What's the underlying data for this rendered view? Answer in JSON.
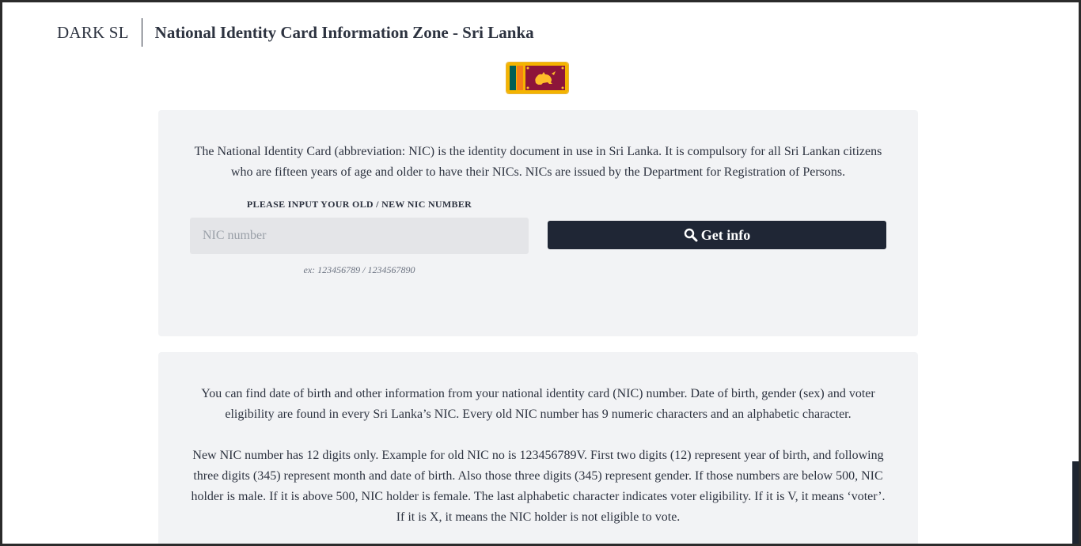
{
  "header": {
    "brand": "DARK SL",
    "title": "National Identity Card Information Zone - Sri Lanka"
  },
  "flag": {
    "icon": "sri-lanka-flag",
    "colors": {
      "border": "#f4b400",
      "green": "#005f56",
      "orange": "#f57f17",
      "maroon": "#8d153a",
      "lion": "#ffbe29"
    }
  },
  "lookup": {
    "intro": "The National Identity Card (abbreviation: NIC) is the identity document in use in Sri Lanka. It is compulsory for all Sri Lankan citizens who are fifteen years of age and older to have their NICs. NICs are issued by the Department for Registration of Persons.",
    "input_label": "PLEASE INPUT YOUR OLD / NEW NIC NUMBER",
    "input_placeholder": "NIC number",
    "input_value": "",
    "hint": "ex: 123456789 / 1234567890",
    "button_label": "Get info",
    "button_icon": "search-icon"
  },
  "info": {
    "paragraph_1": "You can find date of birth and other information from your national identity card (NIC) number. Date of birth, gender (sex) and voter eligibility are found in every Sri Lanka’s NIC. Every old NIC number has 9 numeric characters and an alphabetic character.",
    "paragraph_2": "New NIC number has 12 digits only. Example for old NIC no is 123456789V. First two digits (12) represent year of birth, and following three digits (345) represent month and date of birth. Also those three digits (345) represent gender. If those numbers are below 500, NIC holder is male. If it is above 500, NIC holder is female. The last alphabetic character indicates voter eligibility. If it is V, it means ‘voter’. If it is X, it means the NIC holder is not eligible to vote."
  },
  "theme": {
    "card_background": "#f2f3f5",
    "button_background": "#1f2635",
    "text": "#2d3340"
  }
}
